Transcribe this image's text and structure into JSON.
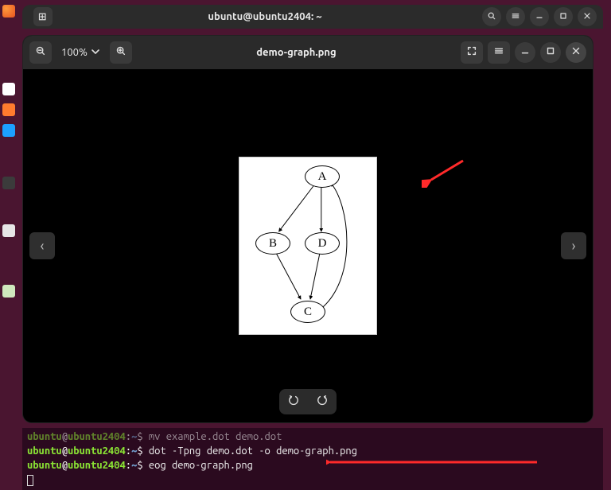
{
  "terminal_window": {
    "title": "ubuntu@ubuntu2404: ~",
    "lines": [
      {
        "user": "ubuntu",
        "at": "@",
        "host": "ubuntu2404",
        "colon": ":",
        "path": "~",
        "prompt": "$",
        "command": "mv example.dot demo.dot",
        "faded": true
      },
      {
        "user": "ubuntu",
        "at": "@",
        "host": "ubuntu2404",
        "colon": ":",
        "path": "~",
        "prompt": "$",
        "command": "dot -Tpng demo.dot -o demo-graph.png"
      },
      {
        "user": "ubuntu",
        "at": "@",
        "host": "ubuntu2404",
        "colon": ":",
        "path": "~",
        "prompt": "$",
        "command": "eog demo-graph.png"
      }
    ]
  },
  "viewer": {
    "zoom": "100%",
    "title": "demo-graph.png"
  },
  "graph": {
    "nodes": {
      "a": "A",
      "b": "B",
      "c": "C",
      "d": "D"
    }
  },
  "icons": {
    "search": "search-icon",
    "hamburger": "hamburger-icon",
    "minimize": "minimize-icon",
    "maximize": "maximize-icon",
    "close": "close-icon",
    "zoom_out": "zoom-out-icon",
    "zoom_in": "zoom-in-icon",
    "chevron_down": "chevron-down-icon",
    "fullscreen": "fullscreen-icon",
    "prev": "chevron-left-icon",
    "next": "chevron-right-icon",
    "rotate_left": "rotate-left-icon",
    "rotate_right": "rotate-right-icon",
    "keyboard": "keyboard-icon"
  }
}
